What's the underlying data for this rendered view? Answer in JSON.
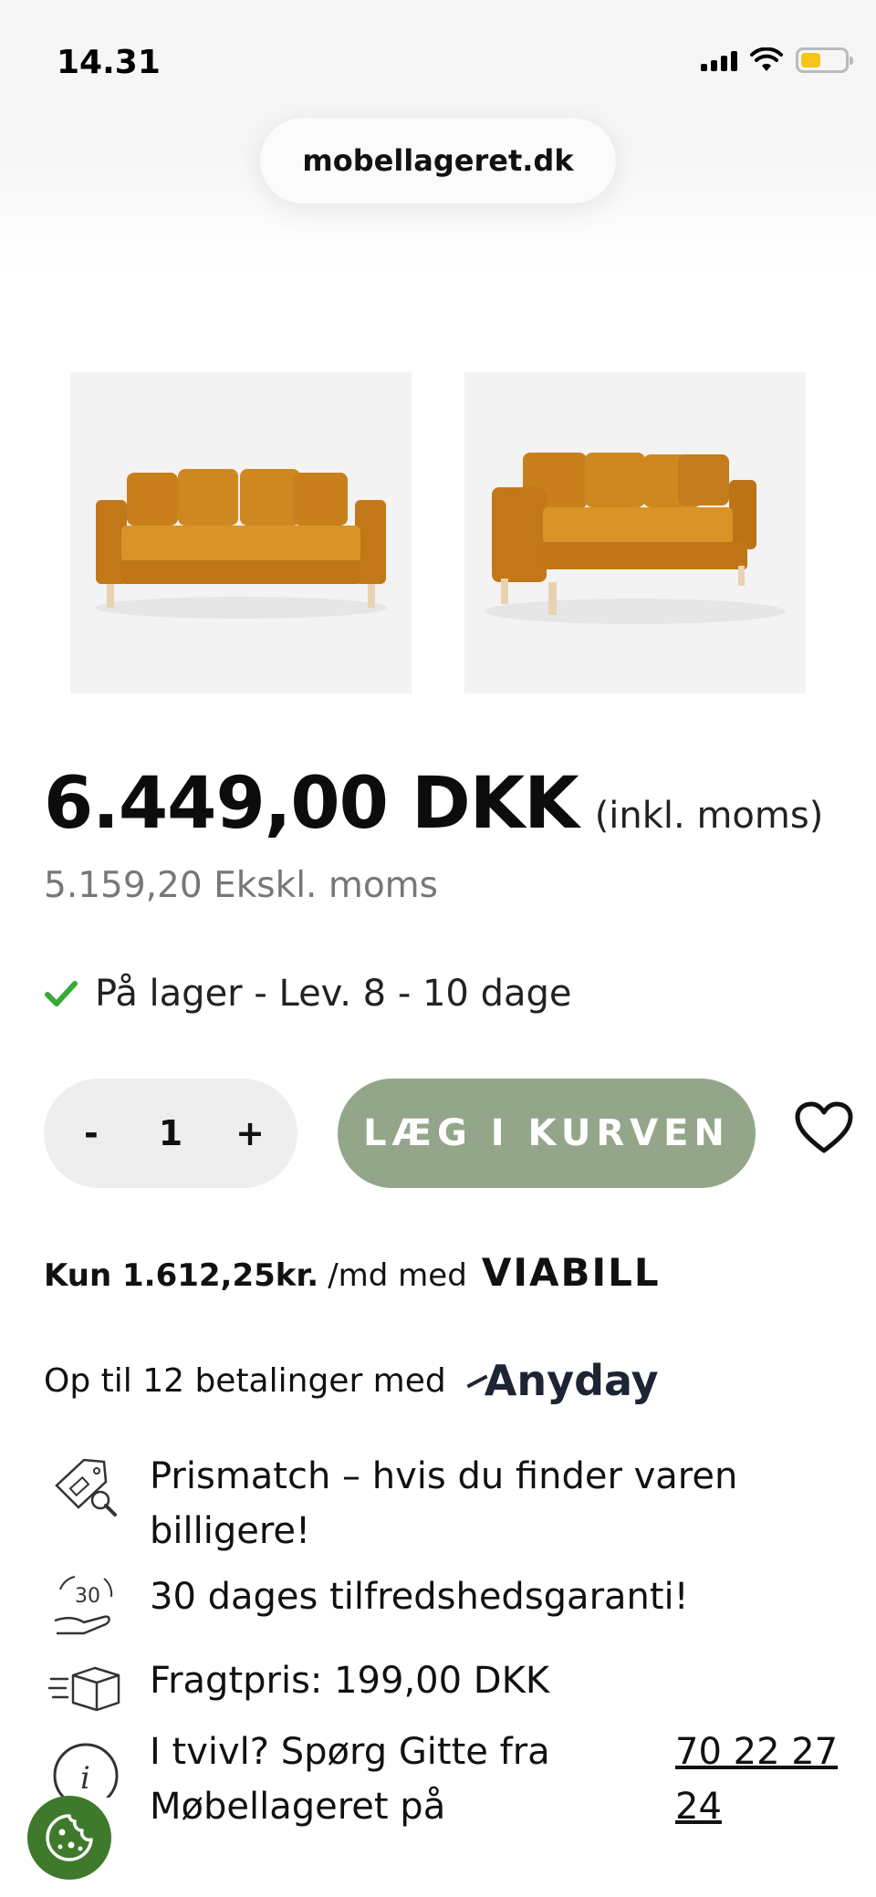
{
  "status_bar": {
    "time": "14.31",
    "battery_color": "#f5c518"
  },
  "browser": {
    "url": "mobellageret.dk"
  },
  "product": {
    "images": [
      {
        "alt": "sofa-front",
        "color": "#d18b22"
      },
      {
        "alt": "sofa-angle",
        "color": "#d18b22"
      }
    ],
    "price": "6.449,00 DKK",
    "price_note": "(inkl. moms)",
    "price_ex_vat": "5.159,20 Ekskl. moms",
    "stock": "På lager - Lev.  8 - 10 dage"
  },
  "purchase": {
    "qty_minus": "-",
    "qty_value": "1",
    "qty_plus": "+",
    "add_to_cart": "LÆG I KURVEN",
    "button_color": "#93a68a"
  },
  "financing": {
    "viabill_amount": "Kun 1.612,25kr.",
    "viabill_suffix": "/md med",
    "viabill_logo": "VIABILL",
    "anyday_text": "Op til 12 betalinger med",
    "anyday_logo": "Anyday"
  },
  "usps": [
    {
      "icon": "price-tag-icon",
      "text": "Prismatch – hvis du finder varen billigere!"
    },
    {
      "icon": "guarantee-30-icon",
      "icon_text": "30",
      "text": "30 dages tilfredshedsgaranti!"
    },
    {
      "icon": "delivery-box-icon",
      "text": "Fragtpris: 199,00 DKK"
    },
    {
      "icon": "info-icon",
      "icon_text": "i",
      "text": "I tvivl? Spørg Gitte fra Møbellageret på",
      "phone": "70 22 27 24"
    }
  ],
  "cookie": {
    "icon": "cookie-icon",
    "color": "#3f7a2c"
  }
}
